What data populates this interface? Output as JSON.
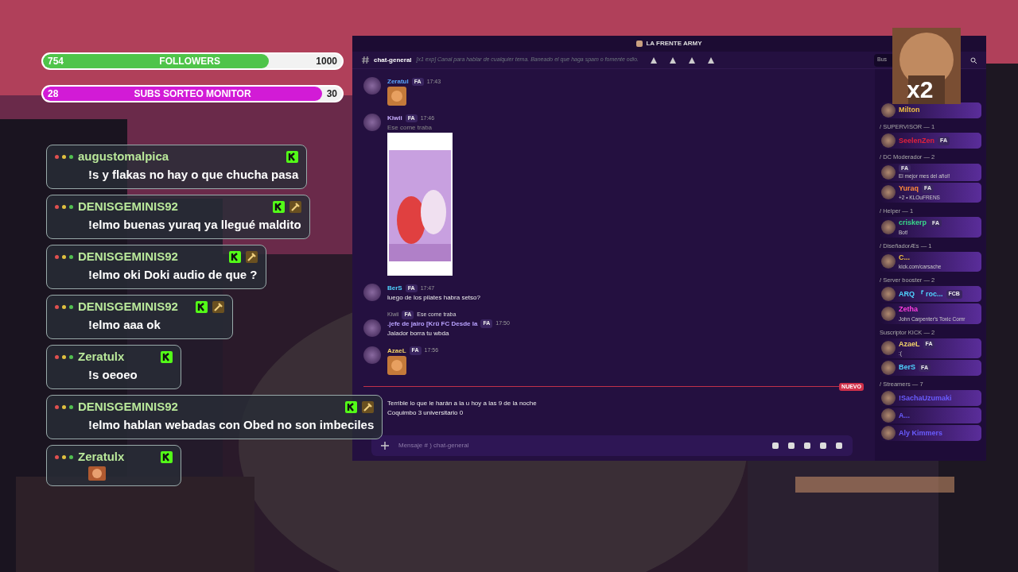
{
  "goals": [
    {
      "label": "FOLLOWERS",
      "current": "754",
      "goal": "1000",
      "level": 0.754,
      "color": "#4fc44a"
    },
    {
      "label": "SUBS SORTEO MONITOR",
      "current": "28",
      "goal": "30",
      "level": 0.933,
      "color": "#d21bd6"
    }
  ],
  "stream_chat": [
    {
      "user": "augustomalpica",
      "text": "!s y flakas no hay o que chucha pasa",
      "kick_badge": true
    },
    {
      "user": "DENISGEMINIS92",
      "text": "!elmo buenas yuraq ya llegué maldito",
      "kick_badge": true,
      "hammer_badge": true
    },
    {
      "user": "DENISGEMINIS92",
      "text": "!elmo oki Doki audio de que ?",
      "kick_badge": true,
      "hammer_badge": true
    },
    {
      "user": "DENISGEMINIS92",
      "text": "!elmo aaa ok",
      "kick_badge": true,
      "hammer_badge": true
    },
    {
      "user": "Zeratulx",
      "text": "!s oeoeo",
      "kick_badge": true
    },
    {
      "user": "DENISGEMINIS92",
      "text": "!elmo hablan webadas con Obed no son imbeciles",
      "kick_badge": true,
      "hammer_badge": true
    },
    {
      "user": "Zeratulx",
      "kind": "emote",
      "kick_badge": true
    }
  ],
  "window": {
    "title": "LA FRENTE ARMY"
  },
  "channel": {
    "name": "chat-general",
    "topic": "[x1 exp] Canal para hablar de cualquier tema. Baneado el que haga spam o fomente odio.",
    "search_placeholder": "Bus"
  },
  "messages": [
    {
      "author": "Zeratul",
      "color": "#5aa7ff",
      "tag": "FA",
      "time": "17:43",
      "kind": "emote"
    },
    {
      "author": "Kiwii",
      "color": "#c9b0ff",
      "tag": "FA",
      "time": "17:46",
      "kind": "video",
      "caption": "Ese come traba"
    },
    {
      "author": "BerS",
      "color": "#4fd3ff",
      "tag": "FA",
      "time": "17:47",
      "kind": "text",
      "text": "luego de los pilates habra setso?"
    },
    {
      "author": ".jefe de jairo [Krü FC Desde la",
      "color": "#b9a2ff",
      "tag": "FA",
      "time": "17:50",
      "kind": "reply",
      "reply_author": "Kiwii",
      "reply_tag": "FA",
      "reply_text": "Ese come traba",
      "text": "Jalador borra tu wbda"
    },
    {
      "author": "AzaeL",
      "color": "#f3d36a",
      "tag": "FA",
      "time": "17:56",
      "kind": "emote"
    },
    {
      "kind": "divider",
      "label": "NUEVO"
    },
    {
      "kind": "lines",
      "lines": [
        "Terrible lo que le harán a la u hoy a las 9 de la noche",
        "Coquimbo 3 universitario 0"
      ]
    }
  ],
  "composer": {
    "placeholder": "Mensaje # ) chat-general"
  },
  "members": [
    {
      "items": [
        {
          "name": "Milton",
          "color": "#f0c040"
        }
      ]
    },
    {
      "group": "/ SUPERVISOR — 1",
      "items": [
        {
          "name": "SeelenZen",
          "color": "#e0203a",
          "tag": "FA"
        }
      ]
    },
    {
      "group": "/ DC Moderador — 2",
      "items": [
        {
          "tag": "FA",
          "status": "El mejor mes del año!!"
        },
        {
          "name": "Yuraq",
          "color": "#ff8a3a",
          "tag": "FA",
          "status": "+2 • KLOuFRENS"
        }
      ]
    },
    {
      "group": "/ Helper — 1",
      "items": [
        {
          "name": "criskerp",
          "color": "#39d98a",
          "tag": "FA",
          "status": "Bot!"
        }
      ]
    },
    {
      "group": "/ DiseñadorÆs — 1",
      "items": [
        {
          "name": "C...",
          "color": "#f0c040",
          "status": "kick.com/carsache"
        }
      ]
    },
    {
      "group": "/ Server booster — 2",
      "items": [
        {
          "name": "ARQ 『 roc...",
          "color": "#4fd3ff",
          "tag": "FCB"
        },
        {
          "name": "Zetha",
          "color": "#ff3de0",
          "status": "John Carpenter's Toxic Comr"
        }
      ]
    },
    {
      "group": "Suscriptor KICK — 2",
      "items": [
        {
          "name": "AzaeL",
          "color": "#f3d36a",
          "tag": "FA",
          "status": ":("
        },
        {
          "name": "BerS",
          "color": "#4fd3ff",
          "tag": "FA"
        }
      ]
    },
    {
      "group": "/ Streamers — 7",
      "items": [
        {
          "name": "!SachaUzumaki",
          "color": "#6a5cff"
        },
        {
          "name": "A...",
          "color": "#6a5cff"
        },
        {
          "name": "Aly Kimmers",
          "color": "#6a5cff"
        }
      ]
    }
  ],
  "overlay": {
    "text": "x2"
  }
}
